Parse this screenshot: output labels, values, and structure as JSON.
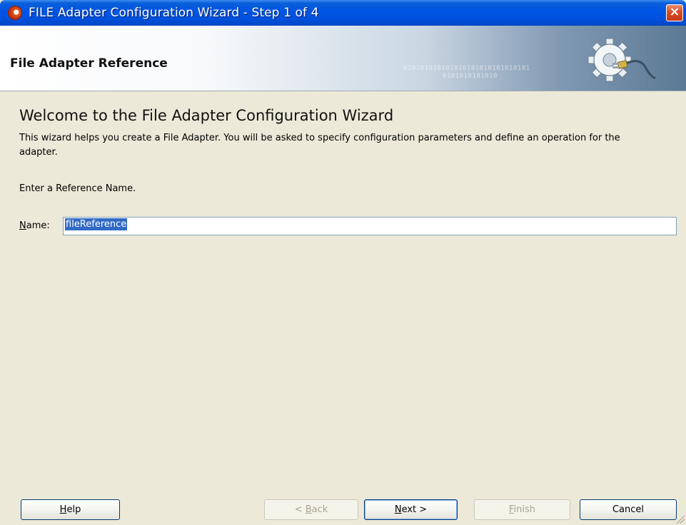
{
  "window": {
    "title": "FILE Adapter Configuration Wizard - Step 1 of 4",
    "close_label": "×"
  },
  "header": {
    "title": "File Adapter Reference",
    "binary_text_1": "010101010101010101010101010101",
    "binary_text_2": "0101010101010"
  },
  "main": {
    "heading": "Welcome to the File Adapter Configuration Wizard",
    "description": "This wizard helps you create a File Adapter. You will be asked to specify configuration parameters and define an operation for the adapter.",
    "prompt": "Enter a Reference Name.",
    "name_field": {
      "label_mnemonic": "N",
      "label_rest": "ame:",
      "value": "fileReference"
    }
  },
  "buttons": {
    "help": {
      "mnemonic": "H",
      "rest": "elp"
    },
    "back": {
      "prefix": "< ",
      "mnemonic": "B",
      "rest": "ack",
      "enabled": false
    },
    "next": {
      "mnemonic": "N",
      "rest": "ext >",
      "enabled": true
    },
    "finish": {
      "mnemonic": "F",
      "rest": "inish",
      "enabled": false
    },
    "cancel": {
      "label": "Cancel"
    }
  },
  "colors": {
    "titlebar": "#0055e5",
    "selection": "#316ac5",
    "dialog_bg": "#ece9d8"
  }
}
